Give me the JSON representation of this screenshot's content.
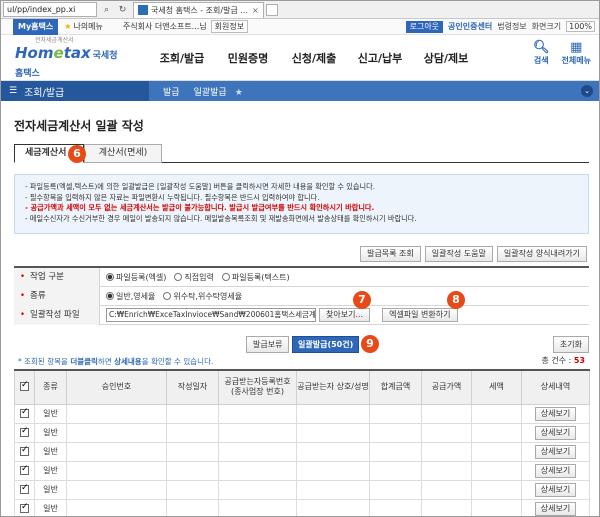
{
  "browser": {
    "url": "ul/pp/index_pp.xi",
    "tab_title": "국세청 홈택스 - 조회/발급 ...",
    "tab_close": "×"
  },
  "util_bar": {
    "my_hometax": "My홈택스",
    "my_menu": "나의메뉴",
    "company": "주식회사 더앤소프트...님",
    "member_info": "회원정보",
    "logout": "로그아웃",
    "cert_center": "공인인증센터",
    "tax_law_info": "법령정보",
    "screen_guide": "화면크기",
    "zoom": "100%"
  },
  "header": {
    "logo_small": "전자세금계산서",
    "logo_main_a": "Hom",
    "logo_main_e": "e",
    "logo_main_b": "tax",
    "logo_korean": "국세청홈택스",
    "nav": [
      "조회/발급",
      "민원증명",
      "신청/제출",
      "신고/납부",
      "상담/제보"
    ],
    "search_label": "검색",
    "allmenu_label": "전체메뉴"
  },
  "breadcrumb": {
    "main": "조회/발급",
    "items": [
      "발급",
      "일괄발급"
    ]
  },
  "page": {
    "title": "전자세금계산서 일괄 작성",
    "tabs": [
      "세금계산서",
      "계산서(면세)"
    ]
  },
  "badges": [
    "6",
    "7",
    "8",
    "9"
  ],
  "notice": {
    "line1": "파일등록(엑셀,텍스트)에 의한 일괄발급은 [일괄작성 도움말] 버튼을 클릭하시면 자세한 내용을 확인할 수 있습니다.",
    "line2": "필수항목을 입력하지 않은 자료는 파일변환시 누락됩니다. 필수항목은 반드시 입력하여야 합니다.",
    "line3": "공급가액과 세액이 모두 없는 세금계산서는 발급이 불가능합니다. 발급시 발급여부를 반드시 확인하시기 바랍니다.",
    "line4": "메일수신자가 수신거부한 경우 메일이 발송되지 않습니다. 메일발송목록조회 및 재발송화면에서 발송상태를 확인하시기 바랍니다."
  },
  "actions": [
    "발급목록 조회",
    "일괄작성 도움말",
    "일괄작성 양식내려가기"
  ],
  "form": {
    "work_type_label": "작업 구분",
    "work_type_options": [
      "파일등록(엑셀)",
      "직접입력",
      "파일등록(텍스트)"
    ],
    "kind_label": "종류",
    "kind_options": [
      "일반,영세율",
      "위수탁,위수탁영세율"
    ],
    "file_label": "일괄작성 파일",
    "file_path": "C:₩Enrich₩ExceTaxInvioce₩Sand₩200601홈택스세금계산서",
    "browse_button": "찾아보기...",
    "convert_button": "엑셀파일 변환하기"
  },
  "controls": {
    "hold_button": "발급보류",
    "bulk_issue_button": "일괄발급(50건)",
    "reset_button": "초기화",
    "hint_pre": "* 조회된 항목을 ",
    "hint_dbl": "더블클릭",
    "hint_mid": "하면 ",
    "hint_detail": "상세내용",
    "hint_post": "을 확인할 수 있습니다.",
    "count_label": "총 건수 : ",
    "count_value": "53"
  },
  "grid": {
    "headers": [
      "종류",
      "승인번호",
      "작성일자",
      "공급받는자등록번호 (종사업장 번호)",
      "공급받는자 상호/성명",
      "합계금액",
      "공급가액",
      "세액",
      "상세내역"
    ],
    "rows": [
      {
        "kind": "일반",
        "view": "상세보기"
      },
      {
        "kind": "일반",
        "view": "상세보기"
      },
      {
        "kind": "일반",
        "view": "상세보기"
      },
      {
        "kind": "일반",
        "view": "상세보기"
      },
      {
        "kind": "일반",
        "view": "상세보기"
      },
      {
        "kind": "일반",
        "view": "상세보기"
      },
      {
        "kind": "일반",
        "view": "상세보기"
      }
    ]
  }
}
